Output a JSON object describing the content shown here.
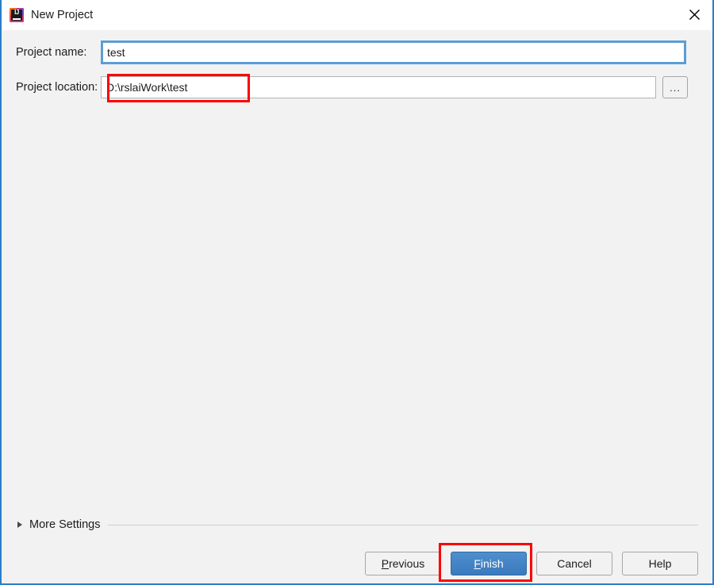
{
  "window": {
    "title": "New Project",
    "app_icon": "intellij-idea-icon",
    "close_icon": "close-icon",
    "border_color": "#2a7fc9",
    "titlebar_bg": "#ffffff",
    "body_bg": "#f2f2f2"
  },
  "form": {
    "project_name": {
      "label": "Project name:",
      "value": "test",
      "focused": true,
      "focus_border_color": "#5a9ed4"
    },
    "project_location": {
      "label": "Project location:",
      "value": "D:\\rslaiWork\\test",
      "browse_button_label": "...",
      "browse_icon": "ellipsis-icon"
    }
  },
  "more_settings": {
    "label": "More Settings",
    "expanded": false,
    "arrow_icon": "chevron-right-icon"
  },
  "footer": {
    "buttons": [
      {
        "label": "Previous",
        "mnemonic": "P",
        "primary": false
      },
      {
        "label": "Finish",
        "mnemonic": "F",
        "primary": true
      },
      {
        "label": "Cancel",
        "mnemonic": "",
        "primary": false
      },
      {
        "label": "Help",
        "mnemonic": "",
        "primary": false
      }
    ],
    "primary_color": "#3a79bd"
  },
  "annotations": {
    "color": "#fe0000",
    "boxes": [
      {
        "target": "project-location-input",
        "label": ""
      },
      {
        "target": "finish-button",
        "label": ""
      }
    ]
  }
}
